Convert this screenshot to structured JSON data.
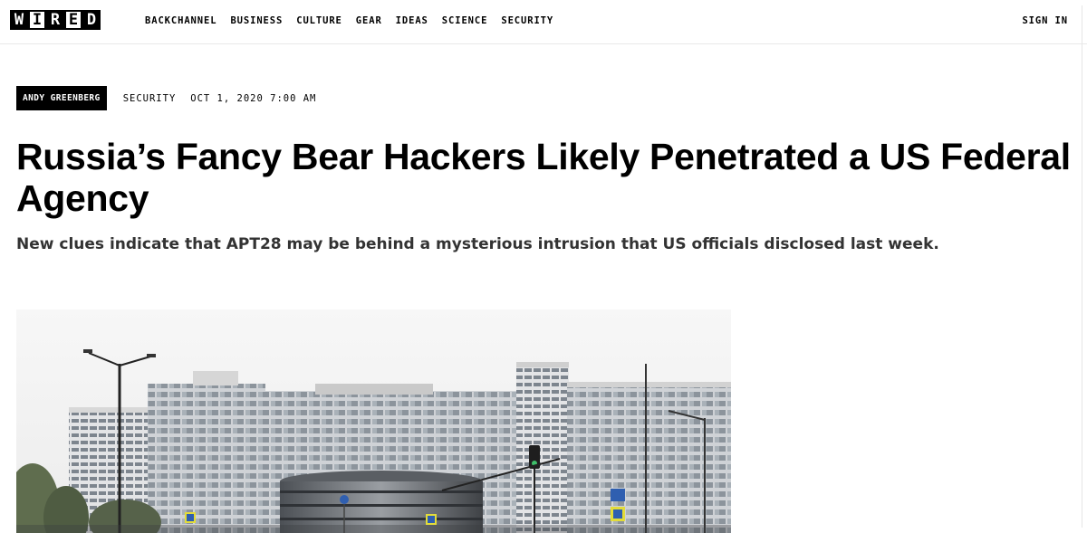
{
  "logo": {
    "letters": [
      "W",
      "I",
      "R",
      "E",
      "D"
    ]
  },
  "nav": {
    "items": [
      "BACKCHANNEL",
      "BUSINESS",
      "CULTURE",
      "GEAR",
      "IDEAS",
      "SCIENCE",
      "SECURITY"
    ],
    "sign_in": "SIGN IN"
  },
  "article": {
    "author": "ANDY GREENBERG",
    "category": "SECURITY",
    "date": "OCT 1, 2020 7:00 AM",
    "headline": "Russia’s Fancy Bear Hackers Likely Penetrated a US Federal Agency",
    "dek": "New clues indicate that APT28 may be behind a mysterious intrusion that US officials disclosed last week."
  },
  "colors": {
    "text": "#000000",
    "dek": "#333333",
    "badge_bg": "#000000",
    "badge_text": "#ffffff"
  }
}
